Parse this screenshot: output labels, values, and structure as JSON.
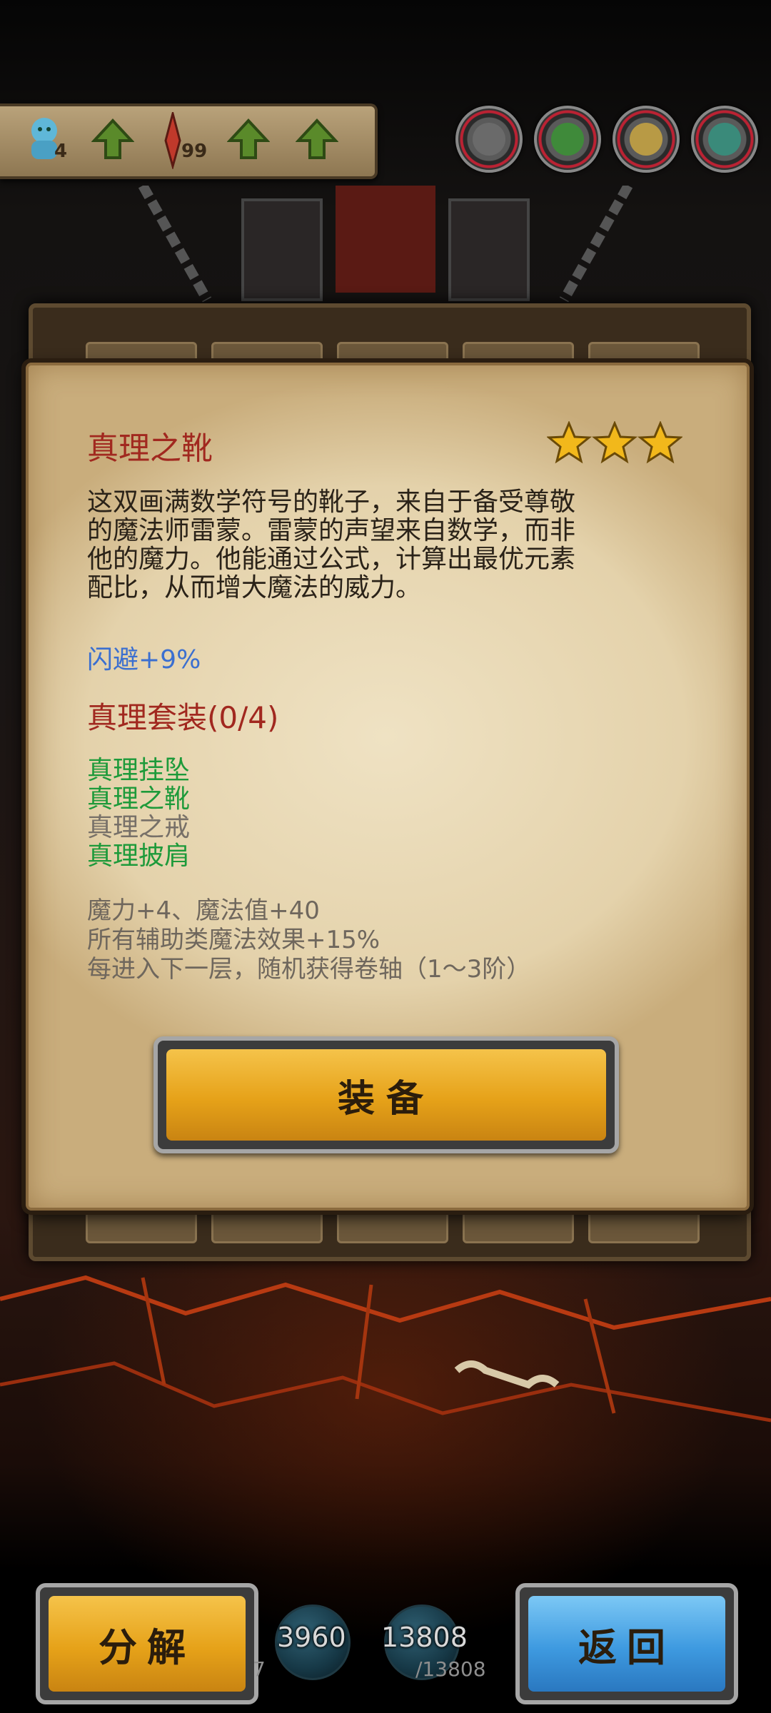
{
  "hud": {
    "player_count": "4",
    "sword_count": "99",
    "portraits": [
      "portrait-1",
      "portrait-2",
      "portrait-3",
      "portrait-4"
    ]
  },
  "item": {
    "name": "真理之靴",
    "stars": 3,
    "description_lines": [
      "这双画满数学符号的靴子，来自于备受尊敬",
      "的魔法师雷蒙。雷蒙的声望来自数学，而非",
      "他的魔力。他能通过公式，计算出最优元素",
      "配比，从而增大魔法的威力。"
    ],
    "stat": "闪避+9%",
    "set_title": "真理套装(0/4)",
    "set_items": [
      {
        "name": "真理挂坠",
        "owned": true
      },
      {
        "name": "真理之靴",
        "owned": true
      },
      {
        "name": "真理之戒",
        "owned": false
      },
      {
        "name": "真理披肩",
        "owned": true
      }
    ],
    "set_bonus_lines": [
      "魔力+4、魔法值+40",
      "所有辅助类魔法效果+15%",
      "每进入下一层，随机获得卷轴（1～3阶）"
    ],
    "equip_label": "装备"
  },
  "footer": {
    "decompose_label": "分解",
    "back_label": "返回",
    "resource1": "3960",
    "resource2": "13808",
    "resource2_max": "/13808",
    "resource1_sub": "7"
  },
  "colors": {
    "title_red": "#a1281f",
    "stat_blue": "#3b6fd0",
    "owned_green": "#1d9a3a",
    "unowned_gray": "#777068",
    "button_gold": "#e6a219",
    "button_blue": "#3e9ae0"
  }
}
